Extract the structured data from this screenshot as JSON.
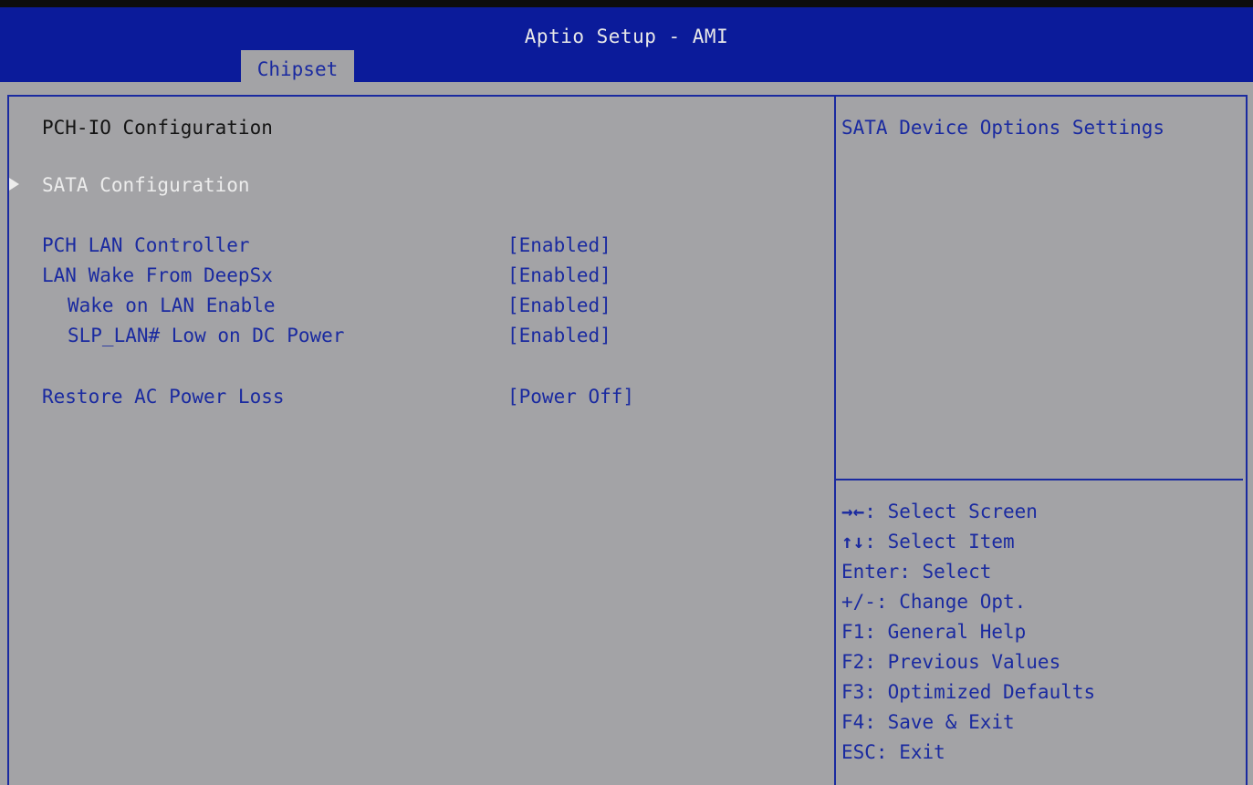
{
  "app": {
    "title": "Aptio Setup - AMI"
  },
  "tabs": [
    {
      "label": "Chipset",
      "active": true
    }
  ],
  "page": {
    "heading": "PCH-IO Configuration",
    "submenu": {
      "label": "SATA Configuration",
      "marker": "▶"
    },
    "settings": [
      {
        "label": "PCH LAN Controller",
        "value": "[Enabled]"
      },
      {
        "label": "LAN Wake From DeepSx",
        "value": "[Enabled]"
      },
      {
        "label": "Wake on LAN Enable",
        "value": "[Enabled]"
      },
      {
        "label": "SLP_LAN# Low on DC Power",
        "value": "[Enabled]"
      },
      {
        "label": "Restore AC Power Loss",
        "value": "[Power Off]"
      }
    ]
  },
  "help": {
    "text": "SATA Device Options Settings"
  },
  "keys": [
    {
      "key": "→←",
      "desc": ": Select Screen"
    },
    {
      "key": "↑↓",
      "desc": ": Select Item"
    },
    {
      "key": "",
      "desc": "Enter: Select"
    },
    {
      "key": "",
      "desc": "+/-: Change Opt."
    },
    {
      "key": "",
      "desc": "F1: General Help"
    },
    {
      "key": "",
      "desc": "F2: Previous Values"
    },
    {
      "key": "",
      "desc": "F3: Optimized Defaults"
    },
    {
      "key": "",
      "desc": "F4: Save & Exit"
    },
    {
      "key": "",
      "desc": "ESC: Exit"
    }
  ],
  "colors": {
    "header_bg": "#0b1b9a",
    "panel_bg": "#a3a3a6",
    "accent_blue": "#1a2aa0",
    "selected_text": "#ececec"
  }
}
